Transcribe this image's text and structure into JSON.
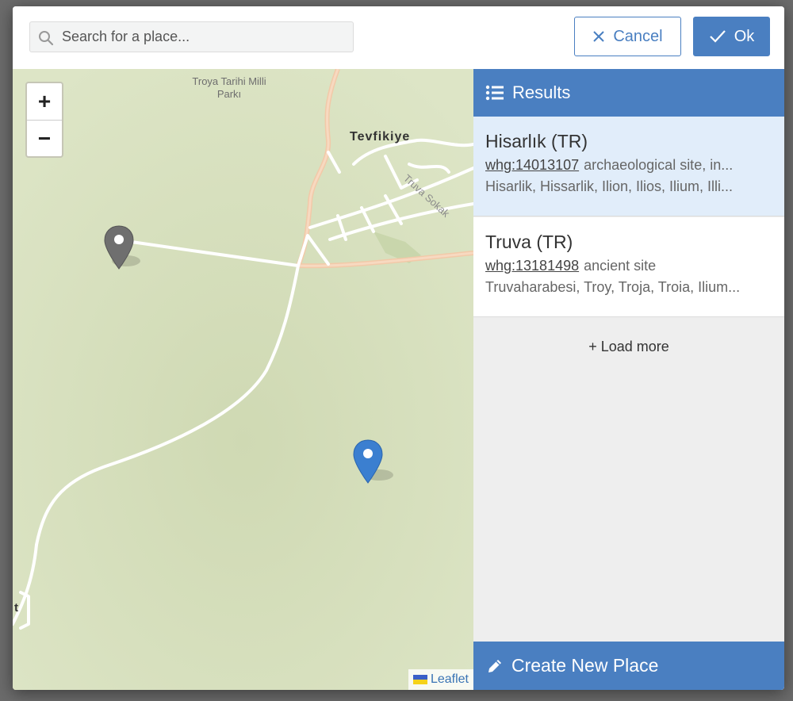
{
  "search": {
    "placeholder": "Search for a place..."
  },
  "buttons": {
    "cancel_label": "Cancel",
    "ok_label": "Ok"
  },
  "map": {
    "zoom_in": "+",
    "zoom_out": "−",
    "labels": {
      "park": "Troya Tarihi Milli Parkı",
      "town": "Tevfikiye",
      "street": "Truva Sokak",
      "edge": "t"
    },
    "attribution": "Leaflet",
    "markers": {
      "grey_color": "#6f6f6f",
      "blue_color": "#3b7fd0"
    }
  },
  "results": {
    "header": "Results",
    "items": [
      {
        "title": "Hisarlık (TR)",
        "id": "whg:14013107",
        "type": "archaeological site, in...",
        "names": "Hisarlik, Hissarlik, Ilion, Ilios, Ilium, Illi..."
      },
      {
        "title": "Truva (TR)",
        "id": "whg:13181498",
        "type": "ancient site",
        "names": "Truvaharabesi, Troy, Troja, Troia, Ilium..."
      }
    ],
    "load_more": "+ Load more",
    "create_new": "Create New Place"
  },
  "colors": {
    "accent": "#4a7fc1",
    "selected_row": "#e1edfa",
    "map_bg": "#dbe3c2"
  }
}
